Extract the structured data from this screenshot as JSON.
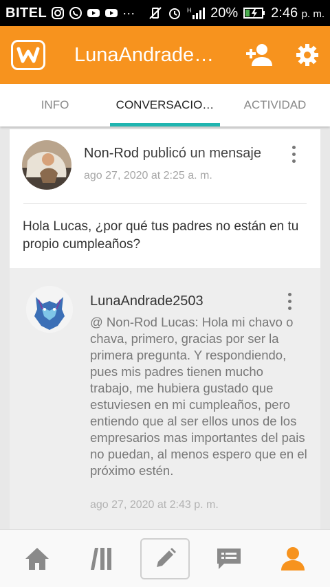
{
  "status_bar": {
    "carrier": "BITEL",
    "battery": "20%",
    "time": "2:46",
    "time_suffix": "p. m.",
    "network": "H"
  },
  "app_bar": {
    "title": "LunaAndrade…",
    "accent_color": "#f7931e"
  },
  "tabs": [
    {
      "label": "INFO",
      "active": false
    },
    {
      "label": "CONVERSACIO…",
      "active": true
    },
    {
      "label": "ACTIVIDAD",
      "active": false
    }
  ],
  "post": {
    "author": "Non-Rod",
    "action": "publicó un mensaje",
    "date": "ago 27, 2020 at 2:25 a. m.",
    "body": "Hola Lucas, ¿por qué tus padres no están en tu propio cumpleaños?"
  },
  "reply": {
    "author": "LunaAndrade2503",
    "body": "@ Non-Rod  Lucas: Hola mi chavo o chava, primero, gracias por ser la primera pregunta. Y respondiendo, pues mis padres tienen mucho trabajo, me hubiera gustado que estuviesen en mi cumpleaños, pero entiendo que al ser ellos unos de los empresarios mas importantes del pais no puedan, al menos espero que en el próximo estén.",
    "date": "ago 27, 2020 at 2:43 p. m."
  },
  "bottom_nav": [
    {
      "icon": "home-icon",
      "active": false
    },
    {
      "icon": "library-icon",
      "active": false
    },
    {
      "icon": "pencil-icon",
      "active": false
    },
    {
      "icon": "messages-icon",
      "active": false
    },
    {
      "icon": "profile-icon",
      "active": true
    }
  ],
  "colors": {
    "tab_indicator": "#1fb5b0",
    "nav_active": "#f7931e",
    "nav_inactive": "#8a8a8a"
  }
}
